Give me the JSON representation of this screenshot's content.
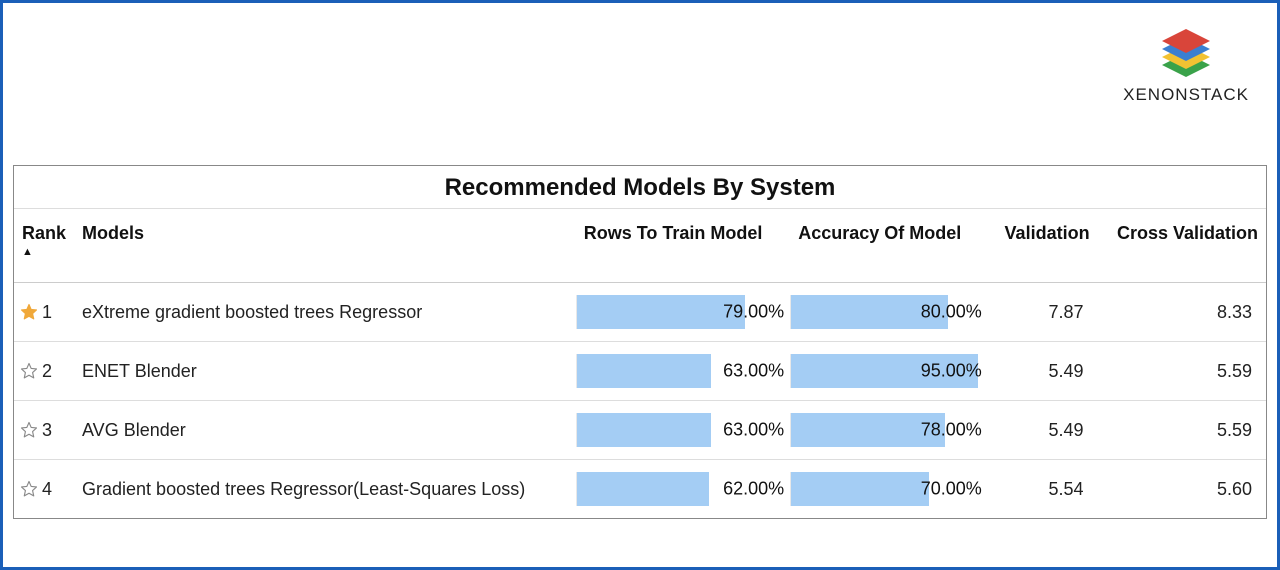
{
  "brand": {
    "name": "XENONSTACK"
  },
  "panel": {
    "title": "Recommended Models By System"
  },
  "columns": {
    "rank": "Rank",
    "models": "Models",
    "rows_to_train": "Rows To Train Model",
    "accuracy": "Accuracy Of Model",
    "validation": "Validation",
    "cross_validation": "Cross Validation"
  },
  "rows": [
    {
      "starred": true,
      "rank": "1",
      "model": "eXtreme gradient boosted trees Regressor",
      "rows_pct": 79,
      "rows_label": "79.00%",
      "acc_pct": 80,
      "acc_label": "80.00%",
      "validation": "7.87",
      "cross_validation": "8.33"
    },
    {
      "starred": false,
      "rank": "2",
      "model": "ENET Blender",
      "rows_pct": 63,
      "rows_label": "63.00%",
      "acc_pct": 95,
      "acc_label": "95.00%",
      "validation": "5.49",
      "cross_validation": "5.59"
    },
    {
      "starred": false,
      "rank": "3",
      "model": "AVG Blender",
      "rows_pct": 63,
      "rows_label": "63.00%",
      "acc_pct": 78,
      "acc_label": "78.00%",
      "validation": "5.49",
      "cross_validation": "5.59"
    },
    {
      "starred": false,
      "rank": "4",
      "model": "Gradient boosted trees Regressor(Least-Squares Loss)",
      "rows_pct": 62,
      "rows_label": "62.00%",
      "acc_pct": 70,
      "acc_label": "70.00%",
      "validation": "5.54",
      "cross_validation": "5.60"
    }
  ],
  "chart_data": {
    "type": "table",
    "title": "Recommended Models By System",
    "columns": [
      "Rank",
      "Models",
      "Rows To Train Model (%)",
      "Accuracy Of Model (%)",
      "Validation",
      "Cross Validation"
    ],
    "rows": [
      [
        1,
        "eXtreme gradient boosted trees Regressor",
        79.0,
        80.0,
        7.87,
        8.33
      ],
      [
        2,
        "ENET Blender",
        63.0,
        95.0,
        5.49,
        5.59
      ],
      [
        3,
        "AVG Blender",
        63.0,
        78.0,
        5.49,
        5.59
      ],
      [
        4,
        "Gradient boosted trees Regressor(Least-Squares Loss)",
        62.0,
        70.0,
        5.54,
        5.6
      ]
    ],
    "bar_columns": [
      "Rows To Train Model (%)",
      "Accuracy Of Model (%)"
    ],
    "bar_range": [
      0,
      100
    ],
    "sort": {
      "column": "Rank",
      "direction": "asc"
    }
  }
}
